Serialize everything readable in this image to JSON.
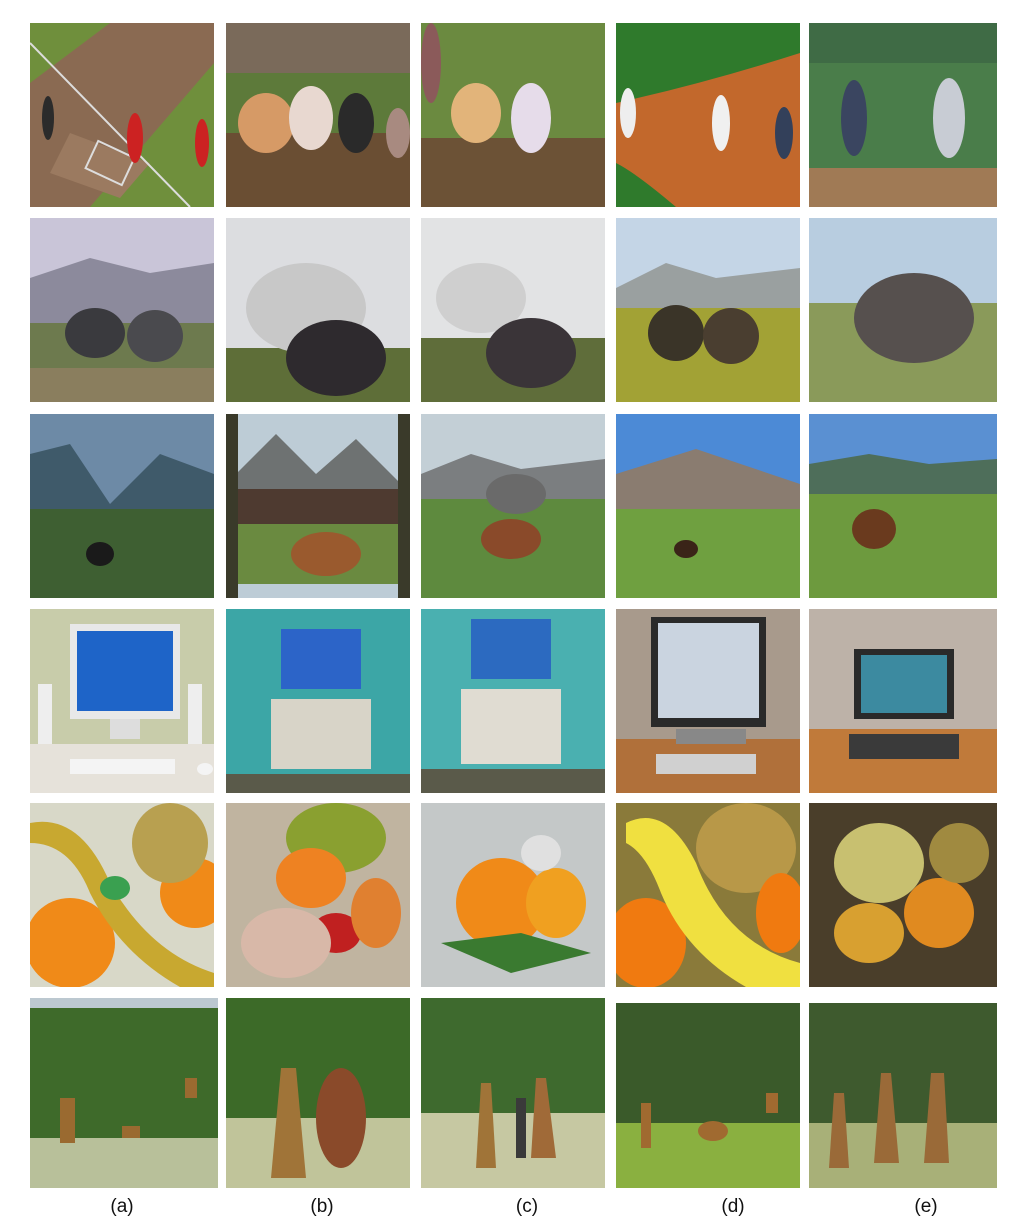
{
  "columns": [
    {
      "label": "(a)"
    },
    {
      "label": "(b)"
    },
    {
      "label": "(c)"
    },
    {
      "label": "(d)"
    },
    {
      "label": "(e)"
    }
  ],
  "rows": [
    {
      "subject": "baseball-field"
    },
    {
      "subject": "elephants"
    },
    {
      "subject": "horse-mountains"
    },
    {
      "subject": "computer-desk"
    },
    {
      "subject": "fruit-bowl"
    },
    {
      "subject": "giraffes"
    }
  ]
}
